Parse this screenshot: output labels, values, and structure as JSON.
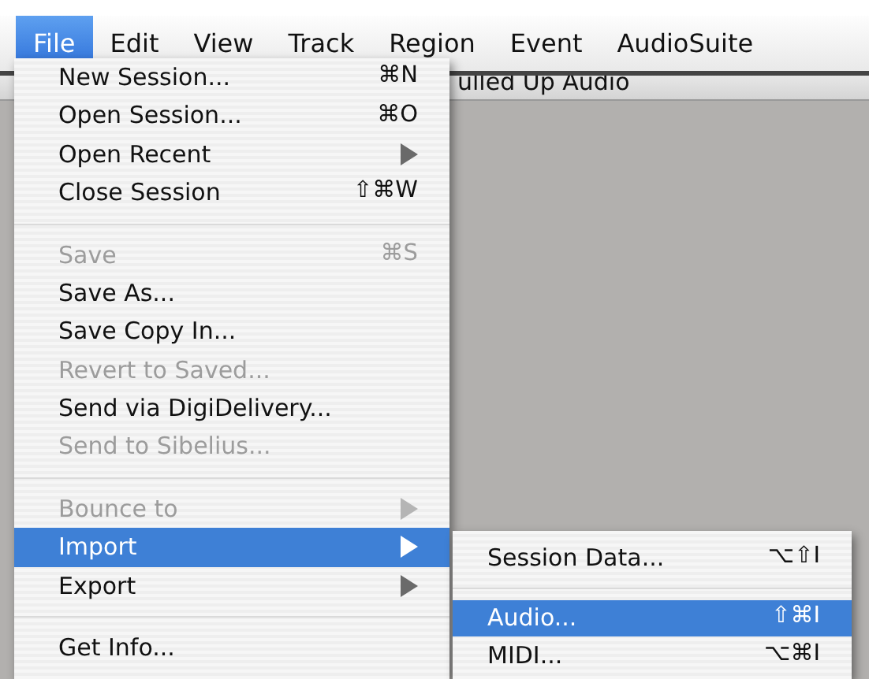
{
  "menu_bar": [
    {
      "label": "File",
      "selected": true
    },
    {
      "label": "Edit",
      "selected": false
    },
    {
      "label": "View",
      "selected": false
    },
    {
      "label": "Track",
      "selected": false
    },
    {
      "label": "Region",
      "selected": false
    },
    {
      "label": "Event",
      "selected": false
    },
    {
      "label": "AudioSuite",
      "selected": false
    }
  ],
  "background_window": {
    "title": "ulled Up Audio"
  },
  "file_menu": [
    {
      "kind": "item",
      "label": "New Session...",
      "shortcut": "⌘N",
      "submenu": false,
      "disabled": false,
      "selected": false
    },
    {
      "kind": "item",
      "label": "Open Session...",
      "shortcut": "⌘O",
      "submenu": false,
      "disabled": false,
      "selected": false
    },
    {
      "kind": "item",
      "label": "Open Recent",
      "submenu": true,
      "disabled": false,
      "selected": false
    },
    {
      "kind": "item",
      "label": "Close Session",
      "shortcut": "⇧⌘W",
      "submenu": false,
      "disabled": false,
      "selected": false
    },
    {
      "kind": "separator"
    },
    {
      "kind": "item",
      "label": "Save",
      "shortcut": "⌘S",
      "submenu": false,
      "disabled": true,
      "selected": false
    },
    {
      "kind": "item",
      "label": "Save As...",
      "submenu": false,
      "disabled": false,
      "selected": false
    },
    {
      "kind": "item",
      "label": "Save Copy In...",
      "submenu": false,
      "disabled": false,
      "selected": false
    },
    {
      "kind": "item",
      "label": "Revert to Saved...",
      "submenu": false,
      "disabled": true,
      "selected": false
    },
    {
      "kind": "item",
      "label": "Send via DigiDelivery...",
      "submenu": false,
      "disabled": false,
      "selected": false
    },
    {
      "kind": "item",
      "label": "Send to Sibelius...",
      "submenu": false,
      "disabled": true,
      "selected": false
    },
    {
      "kind": "separator"
    },
    {
      "kind": "item",
      "label": "Bounce to",
      "submenu": true,
      "disabled": true,
      "selected": false
    },
    {
      "kind": "item",
      "label": "Import",
      "submenu": true,
      "disabled": false,
      "selected": true
    },
    {
      "kind": "item",
      "label": "Export",
      "submenu": true,
      "disabled": false,
      "selected": false
    },
    {
      "kind": "separator"
    },
    {
      "kind": "item",
      "label": "Get Info...",
      "submenu": false,
      "disabled": false,
      "selected": false
    }
  ],
  "import_submenu": [
    {
      "kind": "item",
      "label": "Session Data...",
      "shortcut": "⌥⇧I",
      "submenu": false,
      "disabled": false,
      "selected": false
    },
    {
      "kind": "separator"
    },
    {
      "kind": "item",
      "label": "Audio...",
      "shortcut": "⇧⌘I",
      "submenu": false,
      "disabled": false,
      "selected": true
    },
    {
      "kind": "item",
      "label": "MIDI...",
      "shortcut": "⌥⌘I",
      "submenu": false,
      "disabled": false,
      "selected": false
    }
  ]
}
